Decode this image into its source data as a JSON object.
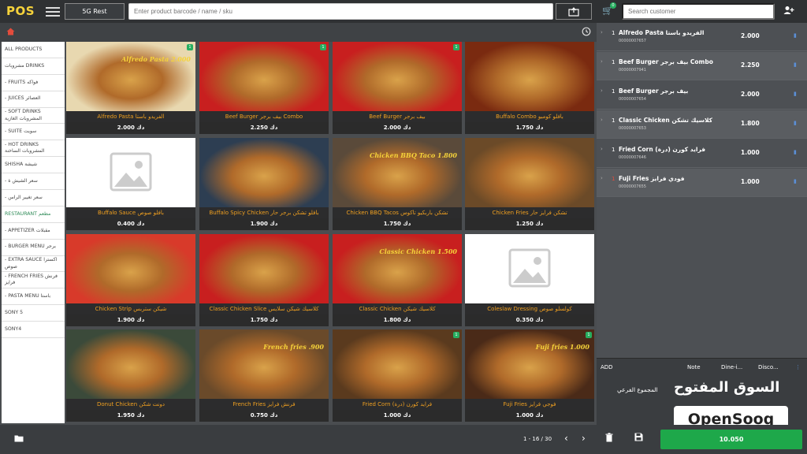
{
  "app": {
    "logo": "POS"
  },
  "topbar": {
    "branch_label": "5G Rest",
    "product_search_placeholder": "Enter product barcode / name / sku",
    "cart_count": "0",
    "customer_search_placeholder": "Search customer"
  },
  "categories": [
    "ALL PRODUCTS",
    "مشروبات DRINKS",
    "- FRUITS فواكه",
    "- JUICES العصائر",
    "- SOFT DRINKS المشروبات الغازية",
    "- SUITE سويت",
    "- HOT DRINKS المشروبات الساخنة",
    "SHISHA شيشة",
    "- سعر الشيش ة",
    "- سعر تغيير الراس",
    "RESTAURANT مطعم",
    "- APPETIZER مقبلات",
    "- BURGER MENU برجر",
    "- EXTRA SAUCE اكسترا صوص",
    "- FRENCH FRIES فرنش فرايز",
    "- PASTA MENU باستا",
    "SONY 5",
    "SONY4"
  ],
  "active_category": "RESTAURANT مطعم",
  "products": [
    {
      "name": "Alfredo Pasta الفريدو باستا",
      "price": "2.000 دك",
      "overlay": "Alfredo Pasta 2.000",
      "badge": "1",
      "color": "#e8d8b0"
    },
    {
      "name": "Beef Burger بيف برجر Combo",
      "price": "2.250 دك",
      "overlay": "",
      "badge": "1",
      "color": "#c81f1f"
    },
    {
      "name": "Beef Burger بيف برجر",
      "price": "2.000 دك",
      "overlay": "",
      "badge": "1",
      "color": "#c81f1f"
    },
    {
      "name": "Buffalo Combo بافلو كومبو",
      "price": "1.750 دك",
      "overlay": "",
      "badge": "",
      "color": "#7a2a10"
    },
    {
      "name": "Buffalo Sauce بافلو صوص",
      "price": "0.400 دك",
      "overlay": "",
      "badge": "",
      "color": "placeholder"
    },
    {
      "name": "Buffalo Spicy Chicken بافلو تشكن برجر حار",
      "price": "1.900 دك",
      "overlay": "",
      "badge": "",
      "color": "#2d3e52"
    },
    {
      "name": "Chicken BBQ Tacos تشكن باربكيو تاكوس",
      "price": "1.750 دك",
      "overlay": "Chicken BBQ Taco 1.800",
      "badge": "",
      "color": "#5a4a3a"
    },
    {
      "name": "Chicken Fries تشكن فرايز حار",
      "price": "1.250 دك",
      "overlay": "",
      "badge": "",
      "color": "#6b4a28"
    },
    {
      "name": "Chicken Strip شيكن ستربس",
      "price": "1.900 دك",
      "overlay": "",
      "badge": "",
      "color": "#d83a2a"
    },
    {
      "name": "Classic Chicken Slice كلاسيك شيكن سلايس",
      "price": "1.750 دك",
      "overlay": "",
      "badge": "",
      "color": "#c81f1f"
    },
    {
      "name": "Classic Chicken كلاسيك شيكن",
      "price": "1.800 دك",
      "overlay": "Classic Chicken 1.500",
      "badge": "",
      "color": "#c81f1f"
    },
    {
      "name": "Coleslaw Dressing كولسلو صوص",
      "price": "0.350 دك",
      "overlay": "",
      "badge": "",
      "color": "placeholder"
    },
    {
      "name": "Donut Chicken دونت شكن",
      "price": "1.950 دك",
      "overlay": "",
      "badge": "",
      "color": "#3b4a3a"
    },
    {
      "name": "French Fries فرنش فرايز",
      "price": "0.750 دك",
      "overlay": "French fries .900",
      "badge": "",
      "color": "#6a4a2a"
    },
    {
      "name": "Fried Corn (درة) فرايد كورن",
      "price": "1.000 دك",
      "overlay": "",
      "badge": "1",
      "color": "#5a3a1e"
    },
    {
      "name": "Fuji Fries فوجي فرايز",
      "price": "1.000 دك",
      "overlay": "Fuji fries 1.000",
      "badge": "1",
      "color": "#4a2a18"
    }
  ],
  "cart": {
    "items": [
      {
        "qty": "1",
        "name": "Alfredo Pasta الفريدو باستا",
        "code": "00000007657",
        "total": "2.000",
        "qty_red": false
      },
      {
        "qty": "1",
        "name": "Beef Burger بيف برجر Combo",
        "code": "00000007941",
        "total": "2.250",
        "qty_red": false
      },
      {
        "qty": "1",
        "name": "Beef Burger بيف برجر",
        "code": "00000007654",
        "total": "2.000",
        "qty_red": false
      },
      {
        "qty": "1",
        "name": "Classic Chicken كلاسيك تشكن",
        "code": "00000007653",
        "total": "1.800",
        "qty_red": false
      },
      {
        "qty": "1",
        "name": "Fried Corn (درة) فرايد كورن",
        "code": "00000007646",
        "total": "1.000",
        "qty_red": false
      },
      {
        "qty": "1",
        "name": "Fuji Fries فودي فرايز",
        "code": "00000007655",
        "total": "1.000",
        "qty_red": true
      }
    ],
    "add_label": "ADD",
    "note_label": "Note",
    "dine_label": "Dine-i...",
    "discount_label": "Disco...",
    "subtotal_label": "المجموع الفرعي",
    "pay_total": "10.050"
  },
  "pagination": {
    "text": "1 - 16 / 30"
  },
  "watermark": {
    "arabic": "السوق المفتوح",
    "english": "OpenSooq"
  }
}
